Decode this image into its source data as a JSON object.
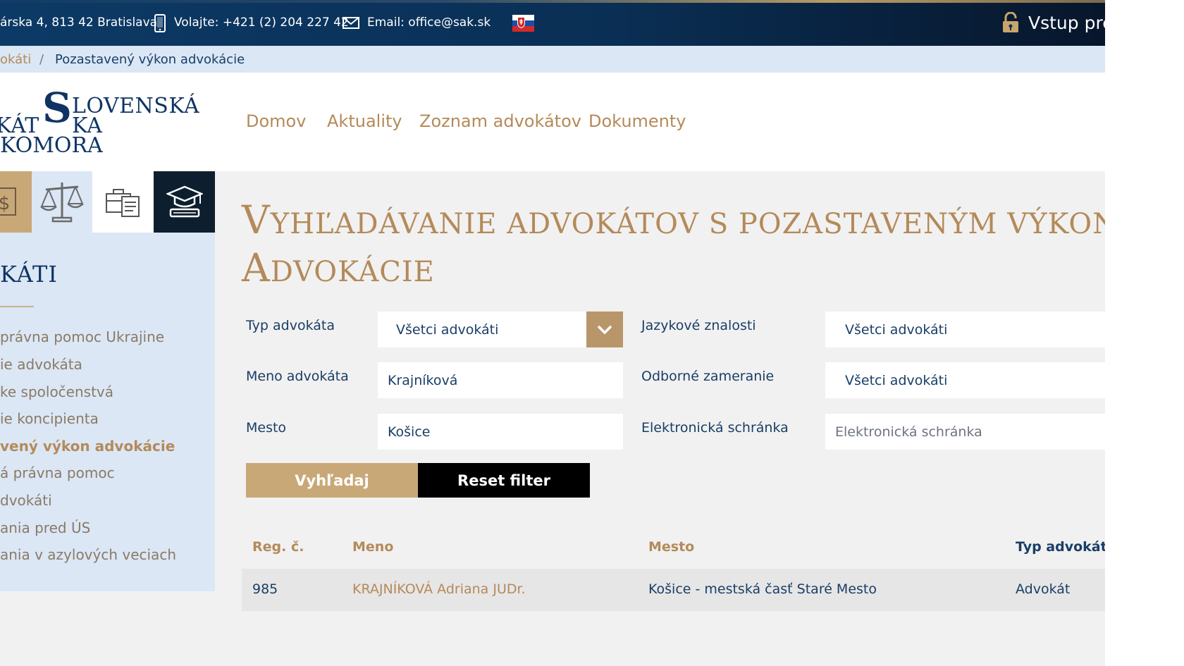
{
  "topbar": {
    "address": "árska 4, 813 42 Bratislava",
    "phone": "Volajte: +421 (2) 204 227 42",
    "email": "Email: office@sak.sk",
    "login": "Vstup pre"
  },
  "breadcrumb": {
    "parent": "okáti",
    "separator": "/",
    "current": "Pozastavený výkon advokácie"
  },
  "logo": {
    "big_s": "S",
    "line1": "LOVENSKÁ",
    "line2": "KÁT",
    "line2b": "KA",
    "line3": "KOMORA"
  },
  "nav": {
    "items": [
      "Domov",
      "Aktuality",
      "Zoznam advokátov",
      "Dokumenty"
    ]
  },
  "sidebar": {
    "title": "KÁTI",
    "items": [
      {
        "label": "právna pomoc Ukrajine",
        "active": false
      },
      {
        "label": "ie advokáta",
        "active": false
      },
      {
        "label": "ke spoločenstvá",
        "active": false
      },
      {
        "label": "ie koncipienta",
        "active": false
      },
      {
        "label": "vený výkon advokácie",
        "active": true
      },
      {
        "label": "á právna pomoc",
        "active": false
      },
      {
        "label": "dvokáti",
        "active": false
      },
      {
        "label": "ania pred ÚS",
        "active": false
      },
      {
        "label": "ania v azylových veciach",
        "active": false
      }
    ],
    "tiles": [
      "money-icon",
      "scales-icon",
      "briefcase-documents-icon",
      "graduation-cap-icon"
    ]
  },
  "heading": {
    "line1_cap": "V",
    "line1_rest": "YHĽADÁVANIE ADVOKÁTOV S POZASTAVENÝM VÝKON",
    "line2_cap": "A",
    "line2_rest": "DVOKÁCIE"
  },
  "form": {
    "type_label": "Typ advokáta",
    "type_value": "Všetci advokáti",
    "name_label": "Meno advokáta",
    "name_value": "Krajníková",
    "city_label": "Mesto",
    "city_value": "Košice",
    "lang_label": "Jazykové znalosti",
    "lang_value": "Všetci advokáti",
    "spec_label": "Odborné zameranie",
    "spec_value": "Všetci advokáti",
    "ebox_label": "Elektronická schránka",
    "ebox_placeholder": "Elektronická schránka",
    "search_button": "Vyhľadaj",
    "reset_button": "Reset filter"
  },
  "table": {
    "headers": [
      "Reg. č.",
      "Meno",
      "Mesto",
      "Typ advokáta"
    ],
    "rows": [
      {
        "reg": "985",
        "name": "KRAJNÍKOVÁ Adriana JUDr.",
        "city": "Košice - mestská časť Staré Mesto",
        "type": "Advokát"
      }
    ]
  },
  "colors": {
    "navy": "#0f3463",
    "gold": "#b48a5a",
    "light_blue": "#dbe7f5"
  }
}
